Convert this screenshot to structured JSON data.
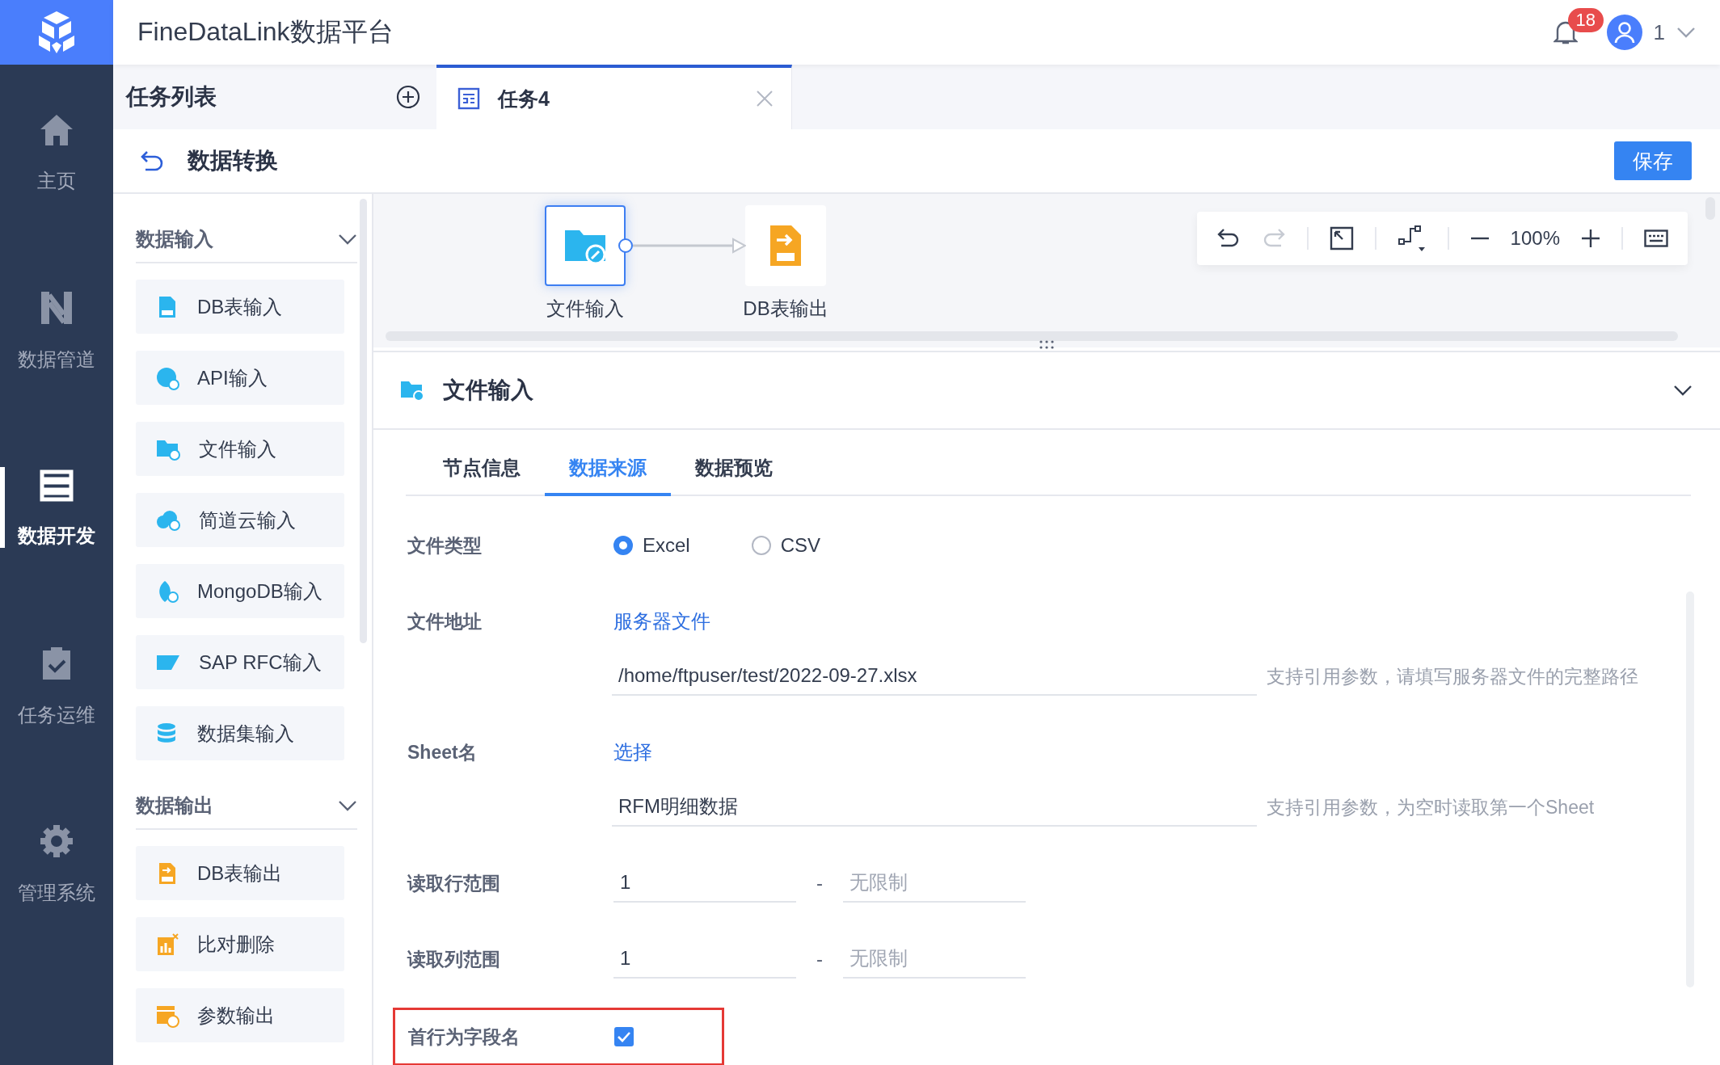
{
  "app": {
    "title": "FineDataLink数据平台"
  },
  "header": {
    "notification_count": "18",
    "user_name": "1"
  },
  "nav": [
    {
      "label": "主页",
      "selected": false
    },
    {
      "label": "数据管道",
      "selected": false
    },
    {
      "label": "数据开发",
      "selected": true
    },
    {
      "label": "任务运维",
      "selected": false
    },
    {
      "label": "管理系统",
      "selected": false
    }
  ],
  "task_tabs": {
    "list_title": "任务列表",
    "tabs": [
      {
        "label": "任务4",
        "selected": true
      }
    ]
  },
  "page": {
    "title": "数据转换",
    "save_button": "保存"
  },
  "palette": [
    {
      "title": "数据输入",
      "expanded": true,
      "items": [
        {
          "label": "DB表输入"
        },
        {
          "label": "API输入"
        },
        {
          "label": "文件输入"
        },
        {
          "label": "简道云输入"
        },
        {
          "label": "MongoDB输入"
        },
        {
          "label": "SAP RFC输入"
        },
        {
          "label": "数据集输入"
        }
      ]
    },
    {
      "title": "数据输出",
      "expanded": true,
      "items": [
        {
          "label": "DB表输出"
        },
        {
          "label": "比对删除"
        },
        {
          "label": "参数输出"
        }
      ]
    }
  ],
  "canvas": {
    "nodes": [
      {
        "label": "文件输入",
        "selected": true
      },
      {
        "label": "DB表输出",
        "selected": false
      }
    ],
    "zoom": "100%"
  },
  "panel": {
    "title": "文件输入",
    "expanded": true,
    "tabs": [
      {
        "label": "节点信息",
        "selected": false
      },
      {
        "label": "数据来源",
        "selected": true
      },
      {
        "label": "数据预览",
        "selected": false
      }
    ],
    "file_type": {
      "label": "文件类型",
      "options": [
        {
          "label": "Excel",
          "selected": true
        },
        {
          "label": "CSV",
          "selected": false
        }
      ]
    },
    "file_address": {
      "label": "文件地址",
      "link": "服务器文件",
      "value": "/home/ftpuser/test/2022-09-27.xlsx",
      "hint": "支持引用参数，请填写服务器文件的完整路径"
    },
    "sheet": {
      "label": "Sheet名",
      "link": "选择",
      "value": "RFM明细数据",
      "hint": "支持引用参数，为空时读取第一个Sheet"
    },
    "row_range": {
      "label": "读取行范围",
      "from": "1",
      "separator": "-",
      "to_placeholder": "无限制"
    },
    "column_range": {
      "label": "读取列范围",
      "from": "1",
      "separator": "-",
      "to_placeholder": "无限制"
    },
    "header_row": {
      "label": "首行为字段名",
      "checked": true,
      "highlighted": true
    }
  }
}
